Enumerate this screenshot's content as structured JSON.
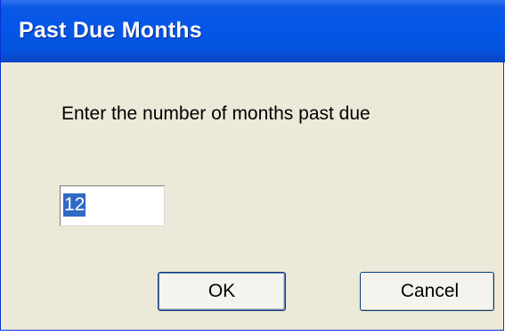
{
  "dialog": {
    "title": "Past Due Months",
    "prompt": "Enter the number of months past due",
    "input_value": "12",
    "ok_label": "OK",
    "cancel_label": "Cancel"
  },
  "colors": {
    "titlebar": "#0556e8",
    "background": "#ece9d8",
    "selection": "#316ac5"
  }
}
